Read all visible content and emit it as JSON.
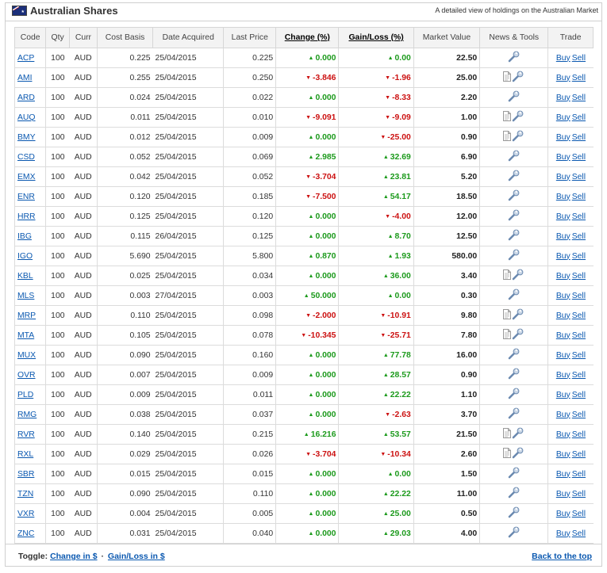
{
  "header": {
    "title": "Australian Shares",
    "subtitle": "A detailed view of holdings on the Australian Market"
  },
  "columns": {
    "code": "Code",
    "qty": "Qty",
    "curr": "Curr",
    "cost_basis": "Cost Basis",
    "date_acquired": "Date Acquired",
    "last_price": "Last Price",
    "change_pct": "Change (%)",
    "gain_loss_pct": "Gain/Loss (%)",
    "market_value": "Market Value",
    "news_tools": "News & Tools",
    "trade": "Trade"
  },
  "trade_labels": {
    "buy": "Buy",
    "sell": "Sell"
  },
  "colors": {
    "up": "#1c9a1c",
    "down": "#cc1111",
    "link": "#0a58b0"
  },
  "rows": [
    {
      "code": "ACP",
      "qty": "100",
      "curr": "AUD",
      "cost": "0.225",
      "date": "25/04/2015",
      "last": "0.225",
      "chg": "0.000",
      "chg_dir": "up",
      "gl": "0.00",
      "gl_dir": "up",
      "mv": "22.50",
      "doc": false
    },
    {
      "code": "AMI",
      "qty": "100",
      "curr": "AUD",
      "cost": "0.255",
      "date": "25/04/2015",
      "last": "0.250",
      "chg": "-3.846",
      "chg_dir": "dn",
      "gl": "-1.96",
      "gl_dir": "dn",
      "mv": "25.00",
      "doc": true
    },
    {
      "code": "ARD",
      "qty": "100",
      "curr": "AUD",
      "cost": "0.024",
      "date": "25/04/2015",
      "last": "0.022",
      "chg": "0.000",
      "chg_dir": "up",
      "gl": "-8.33",
      "gl_dir": "dn",
      "mv": "2.20",
      "doc": false
    },
    {
      "code": "AUQ",
      "qty": "100",
      "curr": "AUD",
      "cost": "0.011",
      "date": "25/04/2015",
      "last": "0.010",
      "chg": "-9.091",
      "chg_dir": "dn",
      "gl": "-9.09",
      "gl_dir": "dn",
      "mv": "1.00",
      "doc": true
    },
    {
      "code": "BMY",
      "qty": "100",
      "curr": "AUD",
      "cost": "0.012",
      "date": "25/04/2015",
      "last": "0.009",
      "chg": "0.000",
      "chg_dir": "up",
      "gl": "-25.00",
      "gl_dir": "dn",
      "mv": "0.90",
      "doc": true
    },
    {
      "code": "CSD",
      "qty": "100",
      "curr": "AUD",
      "cost": "0.052",
      "date": "25/04/2015",
      "last": "0.069",
      "chg": "2.985",
      "chg_dir": "up",
      "gl": "32.69",
      "gl_dir": "up",
      "mv": "6.90",
      "doc": false
    },
    {
      "code": "EMX",
      "qty": "100",
      "curr": "AUD",
      "cost": "0.042",
      "date": "25/04/2015",
      "last": "0.052",
      "chg": "-3.704",
      "chg_dir": "dn",
      "gl": "23.81",
      "gl_dir": "up",
      "mv": "5.20",
      "doc": false
    },
    {
      "code": "ENR",
      "qty": "100",
      "curr": "AUD",
      "cost": "0.120",
      "date": "25/04/2015",
      "last": "0.185",
      "chg": "-7.500",
      "chg_dir": "dn",
      "gl": "54.17",
      "gl_dir": "up",
      "mv": "18.50",
      "doc": false
    },
    {
      "code": "HRR",
      "qty": "100",
      "curr": "AUD",
      "cost": "0.125",
      "date": "25/04/2015",
      "last": "0.120",
      "chg": "0.000",
      "chg_dir": "up",
      "gl": "-4.00",
      "gl_dir": "dn",
      "mv": "12.00",
      "doc": false
    },
    {
      "code": "IBG",
      "qty": "100",
      "curr": "AUD",
      "cost": "0.115",
      "date": "26/04/2015",
      "last": "0.125",
      "chg": "0.000",
      "chg_dir": "up",
      "gl": "8.70",
      "gl_dir": "up",
      "mv": "12.50",
      "doc": false
    },
    {
      "code": "IGO",
      "qty": "100",
      "curr": "AUD",
      "cost": "5.690",
      "date": "25/04/2015",
      "last": "5.800",
      "chg": "0.870",
      "chg_dir": "up",
      "gl": "1.93",
      "gl_dir": "up",
      "mv": "580.00",
      "doc": false
    },
    {
      "code": "KBL",
      "qty": "100",
      "curr": "AUD",
      "cost": "0.025",
      "date": "25/04/2015",
      "last": "0.034",
      "chg": "0.000",
      "chg_dir": "up",
      "gl": "36.00",
      "gl_dir": "up",
      "mv": "3.40",
      "doc": true
    },
    {
      "code": "MLS",
      "qty": "100",
      "curr": "AUD",
      "cost": "0.003",
      "date": "27/04/2015",
      "last": "0.003",
      "chg": "50.000",
      "chg_dir": "up",
      "gl": "0.00",
      "gl_dir": "up",
      "mv": "0.30",
      "doc": false
    },
    {
      "code": "MRP",
      "qty": "100",
      "curr": "AUD",
      "cost": "0.110",
      "date": "25/04/2015",
      "last": "0.098",
      "chg": "-2.000",
      "chg_dir": "dn",
      "gl": "-10.91",
      "gl_dir": "dn",
      "mv": "9.80",
      "doc": true
    },
    {
      "code": "MTA",
      "qty": "100",
      "curr": "AUD",
      "cost": "0.105",
      "date": "25/04/2015",
      "last": "0.078",
      "chg": "-10.345",
      "chg_dir": "dn",
      "gl": "-25.71",
      "gl_dir": "dn",
      "mv": "7.80",
      "doc": true
    },
    {
      "code": "MUX",
      "qty": "100",
      "curr": "AUD",
      "cost": "0.090",
      "date": "25/04/2015",
      "last": "0.160",
      "chg": "0.000",
      "chg_dir": "up",
      "gl": "77.78",
      "gl_dir": "up",
      "mv": "16.00",
      "doc": false
    },
    {
      "code": "OVR",
      "qty": "100",
      "curr": "AUD",
      "cost": "0.007",
      "date": "25/04/2015",
      "last": "0.009",
      "chg": "0.000",
      "chg_dir": "up",
      "gl": "28.57",
      "gl_dir": "up",
      "mv": "0.90",
      "doc": false
    },
    {
      "code": "PLD",
      "qty": "100",
      "curr": "AUD",
      "cost": "0.009",
      "date": "25/04/2015",
      "last": "0.011",
      "chg": "0.000",
      "chg_dir": "up",
      "gl": "22.22",
      "gl_dir": "up",
      "mv": "1.10",
      "doc": false
    },
    {
      "code": "RMG",
      "qty": "100",
      "curr": "AUD",
      "cost": "0.038",
      "date": "25/04/2015",
      "last": "0.037",
      "chg": "0.000",
      "chg_dir": "up",
      "gl": "-2.63",
      "gl_dir": "dn",
      "mv": "3.70",
      "doc": false
    },
    {
      "code": "RVR",
      "qty": "100",
      "curr": "AUD",
      "cost": "0.140",
      "date": "25/04/2015",
      "last": "0.215",
      "chg": "16.216",
      "chg_dir": "up",
      "gl": "53.57",
      "gl_dir": "up",
      "mv": "21.50",
      "doc": true
    },
    {
      "code": "RXL",
      "qty": "100",
      "curr": "AUD",
      "cost": "0.029",
      "date": "25/04/2015",
      "last": "0.026",
      "chg": "-3.704",
      "chg_dir": "dn",
      "gl": "-10.34",
      "gl_dir": "dn",
      "mv": "2.60",
      "doc": true
    },
    {
      "code": "SBR",
      "qty": "100",
      "curr": "AUD",
      "cost": "0.015",
      "date": "25/04/2015",
      "last": "0.015",
      "chg": "0.000",
      "chg_dir": "up",
      "gl": "0.00",
      "gl_dir": "up",
      "mv": "1.50",
      "doc": false
    },
    {
      "code": "TZN",
      "qty": "100",
      "curr": "AUD",
      "cost": "0.090",
      "date": "25/04/2015",
      "last": "0.110",
      "chg": "0.000",
      "chg_dir": "up",
      "gl": "22.22",
      "gl_dir": "up",
      "mv": "11.00",
      "doc": false
    },
    {
      "code": "VXR",
      "qty": "100",
      "curr": "AUD",
      "cost": "0.004",
      "date": "25/04/2015",
      "last": "0.005",
      "chg": "0.000",
      "chg_dir": "up",
      "gl": "25.00",
      "gl_dir": "up",
      "mv": "0.50",
      "doc": false
    },
    {
      "code": "ZNC",
      "qty": "100",
      "curr": "AUD",
      "cost": "0.031",
      "date": "25/04/2015",
      "last": "0.040",
      "chg": "0.000",
      "chg_dir": "up",
      "gl": "29.03",
      "gl_dir": "up",
      "mv": "4.00",
      "doc": false
    }
  ],
  "footer": {
    "toggle_label": "Toggle:",
    "toggle_change": "Change in $",
    "toggle_sep": "·",
    "toggle_gain": "Gain/Loss in $",
    "back_to_top": "Back to the top"
  }
}
